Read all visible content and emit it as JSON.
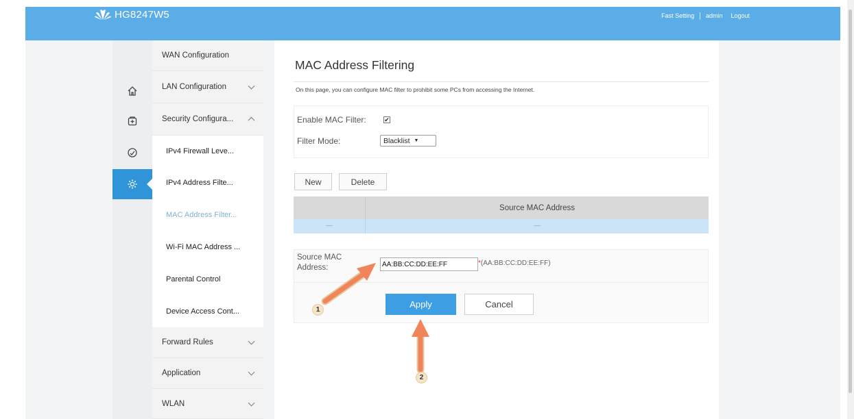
{
  "header": {
    "brand": "HG8247W5",
    "links": {
      "fast_setting": "Fast Setting",
      "separator": "|",
      "user": "admin",
      "logout": "Logout"
    }
  },
  "rail": {
    "items": [
      {
        "icon": "home-icon"
      },
      {
        "icon": "plus-box-icon"
      },
      {
        "icon": "gauge-icon"
      },
      {
        "icon": "gear-icon",
        "active": true
      }
    ]
  },
  "menu": {
    "items": [
      {
        "label": "WAN Configuration"
      },
      {
        "label": "LAN Configuration"
      },
      {
        "label": "Security Configura..."
      },
      {
        "label": "Forward Rules"
      },
      {
        "label": "Application"
      },
      {
        "label": "WLAN"
      }
    ],
    "security_sub": [
      {
        "label": "IPv4 Firewall Leve..."
      },
      {
        "label": "IPv4 Address Filte..."
      },
      {
        "label": "MAC Address Filter..."
      },
      {
        "label": "Wi-Fi MAC Address ..."
      },
      {
        "label": "Parental Control"
      },
      {
        "label": "Device Access Cont..."
      }
    ]
  },
  "main": {
    "title": "MAC Address Filtering",
    "description": "On this page, you can configure MAC filter to prohibit some PCs from accessing the Internet.",
    "enable_label": "Enable MAC Filter:",
    "enable_checked": true,
    "enable_mark": "✔",
    "mode_label": "Filter Mode:",
    "mode_value": "Blacklist",
    "mode_arrow": "▼",
    "new_label": "New",
    "delete_label": "Delete",
    "table": {
      "header": "Source MAC Address",
      "row": [
        "----",
        "----"
      ]
    },
    "form": {
      "mac_label_1": "Source MAC",
      "mac_label_2": "Address:",
      "mac_value": "AA:BB:CC:DD:EE:FF",
      "mac_hint_star": "*",
      "mac_hint": "(AA:BB:CC:DD:EE:FF)",
      "apply_label": "Apply",
      "cancel_label": "Cancel"
    }
  },
  "annotations": {
    "step1": "1",
    "step2": "2",
    "arrow_color": "#f0845a"
  },
  "colors": {
    "header": "#5aade6",
    "accent": "#2f95d8",
    "apply": "#3d9ee4",
    "row_selected": "#cce4f7"
  }
}
